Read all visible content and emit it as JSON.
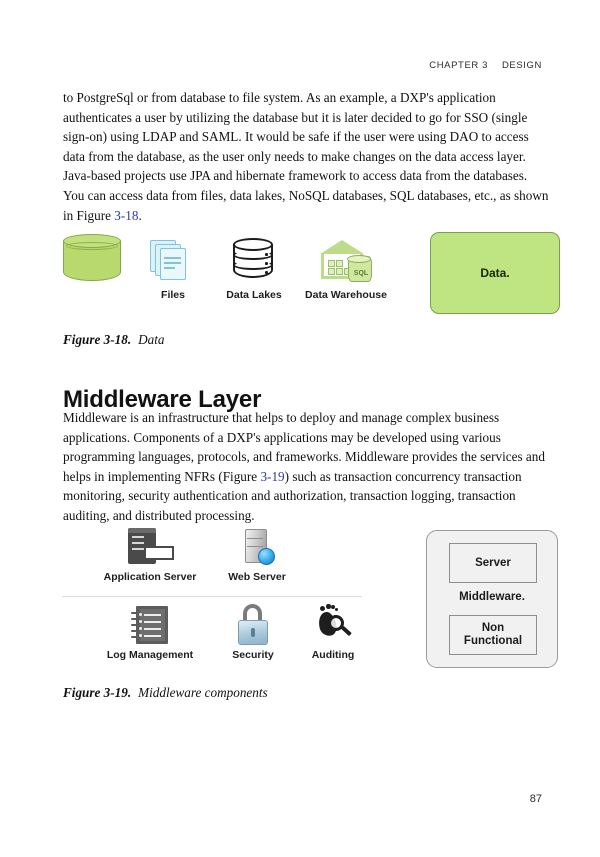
{
  "header": {
    "chapter": "CHAPTER 3",
    "section": "DESIGN"
  },
  "body": {
    "paragraph1": "to PostgreSql or from database to file system. As an example, a DXP's application authenticates a user by utilizing the database but it is later decided to go for SSO (single sign-on) using LDAP and SAML. It would be safe if the user were using DAO to access data from the database, as the user only needs to make changes on the data access layer. Java-based projects use JPA and hibernate framework to access data from the databases. You can access data from files, data lakes, NoSQL databases, SQL databases, etc., as shown in Figure ",
    "paragraph1_link": "3-18",
    "paragraph1_tail": ".",
    "paragraph2_a": "Middleware is an infrastructure that helps to deploy and manage complex business applications. Components of a DXP's applications may be developed using various programming languages, protocols, and frameworks. Middleware provides the services and helps in implementing NFRs (Figure ",
    "paragraph2_link": "3-19",
    "paragraph2_b": ") such as transaction concurrency transaction monitoring, security authentication and authorization, transaction logging, transaction auditing, and distributed processing."
  },
  "heading": {
    "middleware_layer": "Middleware Layer"
  },
  "figure1": {
    "caption_number": "Figure 3-18.",
    "caption_text": "Data",
    "items": [
      {
        "label": "",
        "icon": "green-database-cylinder-icon"
      },
      {
        "label": "Files",
        "icon": "files-icon"
      },
      {
        "label": "Data Lakes",
        "icon": "data-lakes-cylinder-icon"
      },
      {
        "label": "Data Warehouse",
        "icon": "data-warehouse-icon"
      }
    ],
    "sql_badge": "SQL",
    "box_label": "Data.",
    "box_fill": "#bfe583",
    "box_stroke": "#7d9e4d"
  },
  "figure2": {
    "caption_number": "Figure 3-19.",
    "caption_text": "Middleware components",
    "row1": [
      {
        "label": "Application Server",
        "icon": "application-server-icon"
      },
      {
        "label": "Web Server",
        "icon": "web-server-icon"
      }
    ],
    "row2": [
      {
        "label": "Log Management",
        "icon": "log-management-icon"
      },
      {
        "label": "Security",
        "icon": "padlock-icon"
      },
      {
        "label": "Auditing",
        "icon": "footprint-magnifier-icon"
      }
    ],
    "diagram": {
      "top_box": "Server",
      "middle_label": "Middleware.",
      "bottom_box_line1": "Non",
      "bottom_box_line2": "Functional",
      "fill": "#f1f1f1",
      "stroke": "#9b9b9b"
    }
  },
  "folio": {
    "page_number": "87"
  },
  "colors": {
    "link": "#2b3c99",
    "text": "#111111"
  }
}
